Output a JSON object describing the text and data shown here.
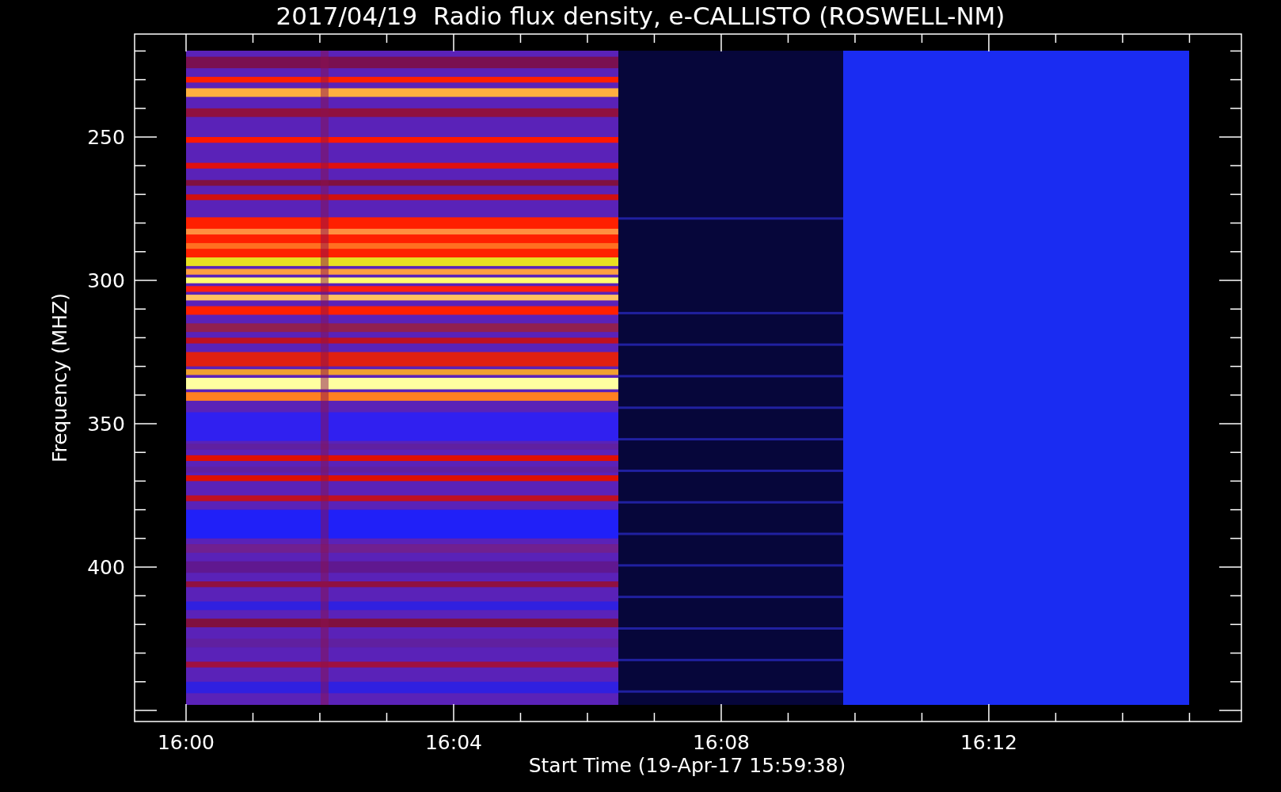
{
  "plot": {
    "title": "2017/04/19  Radio flux density, e-CALLISTO (ROSWELL-NM)",
    "x_axis": {
      "label": "Start Time (19-Apr-17 15:59:38)",
      "tick_labels": [
        "16:00",
        "16:04",
        "16:08",
        "16:12"
      ]
    },
    "y_axis": {
      "label": "Frequency (MHZ)",
      "tick_labels": [
        "250",
        "300",
        "350",
        "400"
      ]
    }
  }
}
